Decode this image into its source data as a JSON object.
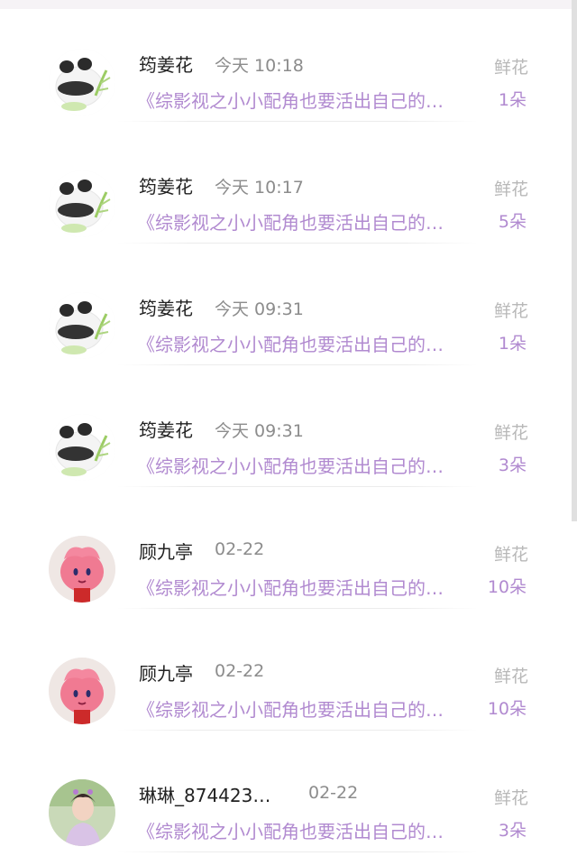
{
  "items": [
    {
      "name": "筠姜花",
      "time": "今天 10:18",
      "book": "《综影视之小小配角也要活出自己的…",
      "gift": "鲜花",
      "count": "1朵",
      "avatar": "panda-avatar"
    },
    {
      "name": "筠姜花",
      "time": "今天 10:17",
      "book": "《综影视之小小配角也要活出自己的…",
      "gift": "鲜花",
      "count": "5朵",
      "avatar": "panda-avatar"
    },
    {
      "name": "筠姜花",
      "time": "今天 09:31",
      "book": "《综影视之小小配角也要活出自己的…",
      "gift": "鲜花",
      "count": "1朵",
      "avatar": "panda-avatar"
    },
    {
      "name": "筠姜花",
      "time": "今天 09:31",
      "book": "《综影视之小小配角也要活出自己的…",
      "gift": "鲜花",
      "count": "3朵",
      "avatar": "panda-avatar"
    },
    {
      "name": "顾九亭",
      "time": "02-22",
      "book": "《综影视之小小配角也要活出自己的…",
      "gift": "鲜花",
      "count": "10朵",
      "avatar": "pink-plush-avatar"
    },
    {
      "name": "顾九亭",
      "time": "02-22",
      "book": "《综影视之小小配角也要活出自己的…",
      "gift": "鲜花",
      "count": "10朵",
      "avatar": "pink-plush-avatar"
    },
    {
      "name": "琳琳_874423…",
      "time": "02-22",
      "book": "《综影视之小小配角也要活出自己的…",
      "gift": "鲜花",
      "count": "3朵",
      "avatar": "photo-avatar"
    }
  ]
}
